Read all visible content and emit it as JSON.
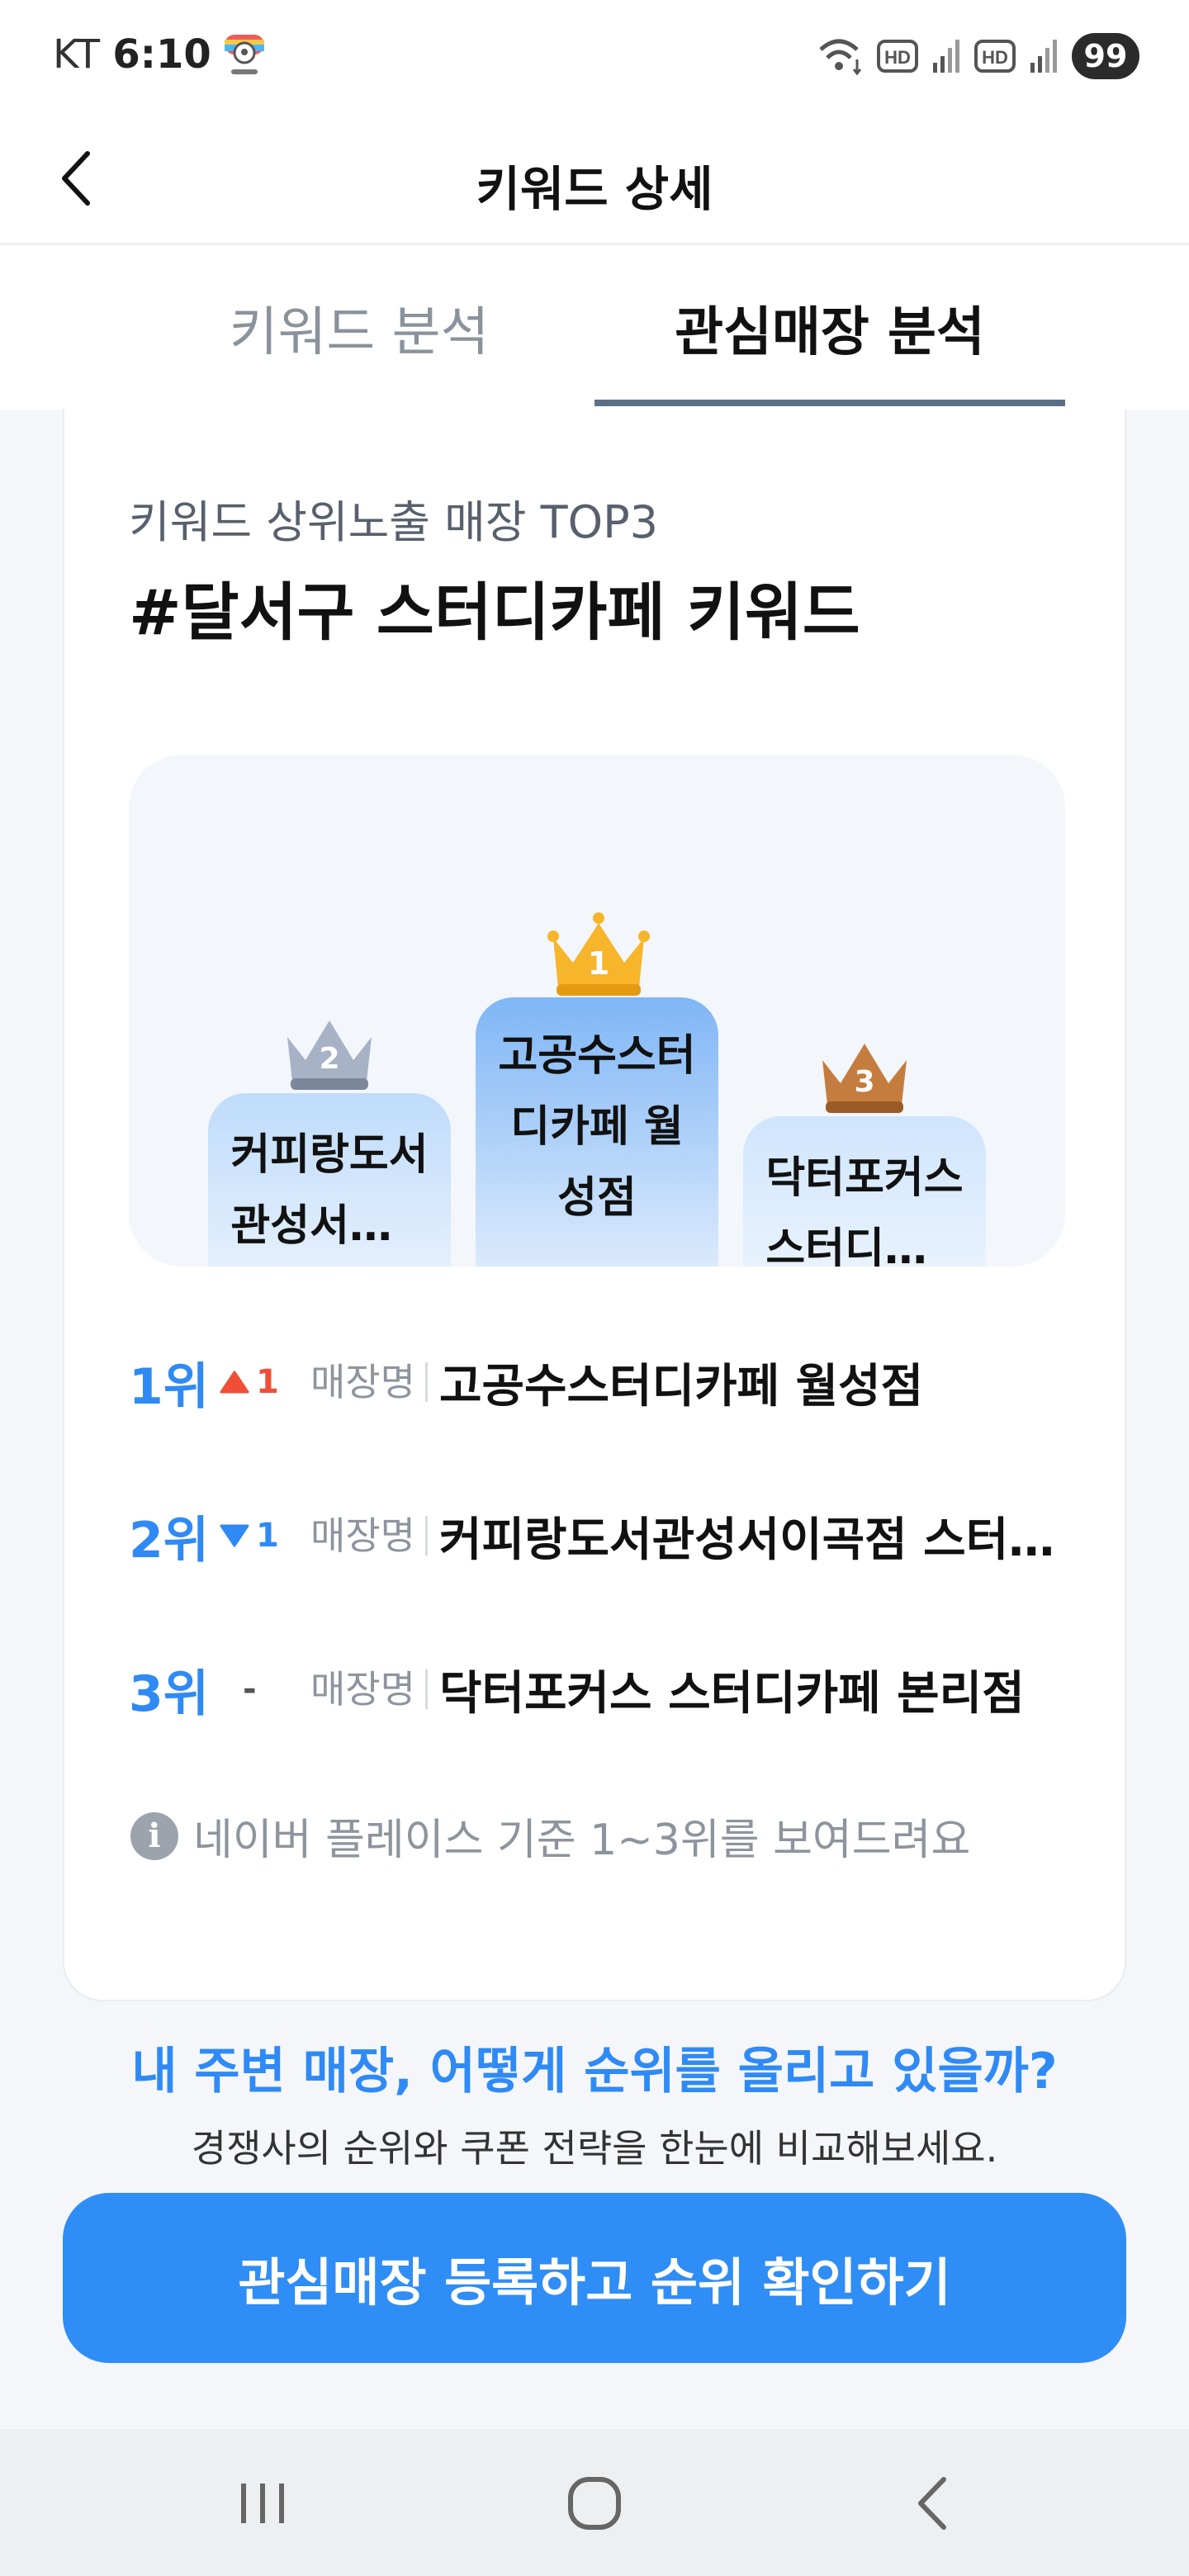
{
  "status_bar": {
    "carrier": "KT",
    "time": "6:10",
    "battery": "99"
  },
  "header": {
    "title": "키워드 상세"
  },
  "tabs": [
    {
      "label": "키워드 분석",
      "active": false
    },
    {
      "label": "관심매장 분석",
      "active": true
    }
  ],
  "card": {
    "subtitle": "키워드 상위노출 매장 TOP3",
    "title": "#달서구 스터디카페 키워드",
    "podium": [
      {
        "rank": "1",
        "name": "고공수스터디카페 월성점"
      },
      {
        "rank": "2",
        "name": "커피랑도서관성서이곡점 스터디카페"
      },
      {
        "rank": "3",
        "name": "닥터포커스 스터디카페 본리점"
      }
    ],
    "rankings": [
      {
        "rank": "1위",
        "change": "1",
        "direction": "up",
        "label": "매장명",
        "name": "고공수스터디카페 월성점"
      },
      {
        "rank": "2위",
        "change": "1",
        "direction": "down",
        "label": "매장명",
        "name": "커피랑도서관성서이곡점 스터디카페"
      },
      {
        "rank": "3위",
        "change": "-",
        "direction": "none",
        "label": "매장명",
        "name": "닥터포커스 스터디카페 본리점"
      }
    ],
    "info": "네이버 플레이스 기준 1~3위를 보여드려요"
  },
  "promo": {
    "title": "내 주변 매장, 어떻게 순위를 올리고 있을까?",
    "description": "경쟁사의 순위와 쿠폰 전략을 한눈에 비교해보세요."
  },
  "cta": {
    "label": "관심매장 등록하고 순위 확인하기"
  },
  "colors": {
    "accent": "#2f8df6",
    "up": "#f04e36",
    "down": "#2f8af5",
    "gold": "#f7b52c",
    "silver": "#8e9bb3",
    "bronze": "#b86f33"
  },
  "icons": {
    "back": "chevron-left-icon",
    "info": "info-icon",
    "nav_recent": "recent-apps-icon",
    "nav_home": "home-icon",
    "nav_back": "back-icon"
  }
}
